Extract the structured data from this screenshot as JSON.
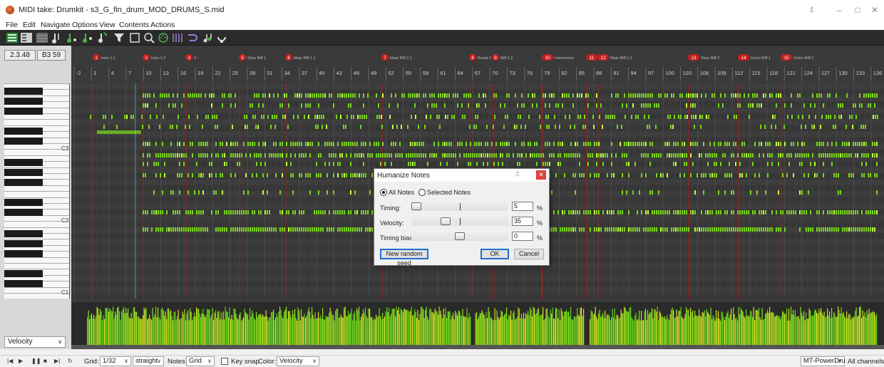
{
  "window": {
    "title": "MIDI take: Drumkit - s3_G_fin_drum_MOD_DRUMS_S.mid",
    "controls": [
      "pin-icon",
      "minimize-icon",
      "maximize-icon",
      "close-icon"
    ]
  },
  "menu": [
    "File",
    "Edit",
    "Navigate",
    "Options",
    "View",
    "Contents",
    "Actions"
  ],
  "toolbar": {
    "icons": [
      "piano-roll-icon",
      "named-notes-icon",
      "drum-grid-icon",
      "step-input-icon",
      "quantize-icon",
      "humanize-icon",
      "length-icon",
      "filter-icon",
      "event-list-icon",
      "zoom-icon",
      "midi-icon",
      "grid-icon",
      "loop-icon",
      "notes-icon",
      "chord-icon"
    ]
  },
  "position": {
    "time": "2.3.48",
    "note": "B3 59"
  },
  "ruler": {
    "markers": [
      {
        "num": "1",
        "name": "Intro 1.1"
      },
      {
        "num": "2",
        "name": "Intro 1.2"
      },
      {
        "num": "3",
        "name": "4"
      },
      {
        "num": "5",
        "name": "Slow Riff 1"
      },
      {
        "num": "6",
        "name": "Main Riff 1.1"
      },
      {
        "num": "7",
        "name": "Main Riff 2.1"
      },
      {
        "num": "8",
        "name": "Break 2"
      },
      {
        "num": "9",
        "name": "Riff 1.2"
      },
      {
        "num": "10",
        "name": "Intermezzo"
      },
      {
        "num": "11",
        "name": ""
      },
      {
        "num": "12",
        "name": "Main Riff 2.2"
      },
      {
        "num": "13",
        "name": "Slow Riff 2"
      },
      {
        "num": "14",
        "name": "Outro Riff 1"
      },
      {
        "num": "15",
        "name": "Outro Riff 2"
      }
    ],
    "bars": [
      "-2",
      "1",
      "4",
      "7",
      "10",
      "13",
      "16",
      "19",
      "22",
      "25",
      "28",
      "31",
      "34",
      "37",
      "40",
      "43",
      "46",
      "49",
      "52",
      "55",
      "58",
      "61",
      "64",
      "67",
      "70",
      "73",
      "76",
      "79",
      "82",
      "85",
      "88",
      "91",
      "94",
      "97",
      "100",
      "103",
      "106",
      "109",
      "112",
      "115",
      "118",
      "121",
      "124",
      "127",
      "130",
      "133",
      "136"
    ]
  },
  "keyboard": {
    "labels": [
      "C3",
      "C2",
      "C1"
    ]
  },
  "velocity_lane": {
    "label": "Velocity"
  },
  "dialog": {
    "title": "Humanize Notes",
    "scope_all": "All Notes",
    "scope_selected": "Selected Notes",
    "timing_label": "Timing:",
    "timing_value": "5",
    "velocity_label": "Velocity:",
    "velocity_value": "35",
    "bias_label": "Timing bias:",
    "bias_value": "0",
    "percent": "%",
    "seed_button": "New random seed",
    "ok_button": "OK",
    "cancel_button": "Cancel",
    "selected_scope": "all"
  },
  "bottom": {
    "grid_label": "Grid:",
    "grid_value": "1/32",
    "swing_value": "straight",
    "notes_label": "Notes:",
    "notes_value": "Grid",
    "keysnap_label": "Key snap",
    "color_label": "Color:",
    "color_value": "Velocity",
    "synth_value": "MT-PowerDru",
    "channel_value": "All channels"
  },
  "colors": {
    "note_green": "#7cdc1e",
    "note_bright": "#b8ff3a",
    "marker_red": "#c41f1f",
    "playhead": "#3aa3a0"
  }
}
